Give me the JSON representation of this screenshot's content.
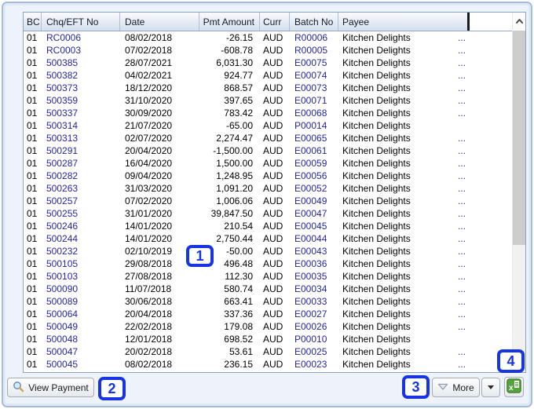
{
  "table": {
    "columns": [
      {
        "key": "bc",
        "label": "BC"
      },
      {
        "key": "chq",
        "label": "Chq/EFT No"
      },
      {
        "key": "date",
        "label": "Date"
      },
      {
        "key": "amount",
        "label": "Pmt Amount"
      },
      {
        "key": "curr",
        "label": "Curr"
      },
      {
        "key": "batch",
        "label": "Batch No"
      },
      {
        "key": "payee",
        "label": "Payee"
      }
    ],
    "rows": [
      {
        "bc": "01",
        "chq": "RC0006",
        "date": "08/02/2018",
        "amount": "-26.15",
        "curr": "AUD",
        "batch": "R00006",
        "payee": "Kitchen Delights",
        "more": "..."
      },
      {
        "bc": "01",
        "chq": "RC0003",
        "date": "07/02/2018",
        "amount": "-608.78",
        "curr": "AUD",
        "batch": "R00005",
        "payee": "Kitchen Delights",
        "more": "..."
      },
      {
        "bc": "01",
        "chq": "500385",
        "date": "28/07/2021",
        "amount": "6,031.30",
        "curr": "AUD",
        "batch": "E00075",
        "payee": "Kitchen Delights",
        "more": "..."
      },
      {
        "bc": "01",
        "chq": "500382",
        "date": "04/02/2021",
        "amount": "924.77",
        "curr": "AUD",
        "batch": "E00074",
        "payee": "Kitchen Delights",
        "more": "..."
      },
      {
        "bc": "01",
        "chq": "500373",
        "date": "18/12/2020",
        "amount": "868.57",
        "curr": "AUD",
        "batch": "E00073",
        "payee": "Kitchen Delights",
        "more": "..."
      },
      {
        "bc": "01",
        "chq": "500359",
        "date": "31/10/2020",
        "amount": "397.65",
        "curr": "AUD",
        "batch": "E00071",
        "payee": "Kitchen Delights",
        "more": "..."
      },
      {
        "bc": "01",
        "chq": "500337",
        "date": "30/09/2020",
        "amount": "783.42",
        "curr": "AUD",
        "batch": "E00068",
        "payee": "Kitchen Delights",
        "more": "..."
      },
      {
        "bc": "01",
        "chq": "500314",
        "date": "21/07/2020",
        "amount": "-65.00",
        "curr": "AUD",
        "batch": "P00014",
        "payee": "Kitchen Delights",
        "more": ""
      },
      {
        "bc": "01",
        "chq": "500313",
        "date": "02/07/2020",
        "amount": "2,274.47",
        "curr": "AUD",
        "batch": "E00065",
        "payee": "Kitchen Delights",
        "more": "..."
      },
      {
        "bc": "01",
        "chq": "500291",
        "date": "20/04/2020",
        "amount": "-1,500.00",
        "curr": "AUD",
        "batch": "E00061",
        "payee": "Kitchen Delights",
        "more": "..."
      },
      {
        "bc": "01",
        "chq": "500287",
        "date": "16/04/2020",
        "amount": "1,500.00",
        "curr": "AUD",
        "batch": "E00059",
        "payee": "Kitchen Delights",
        "more": "..."
      },
      {
        "bc": "01",
        "chq": "500282",
        "date": "09/04/2020",
        "amount": "1,248.95",
        "curr": "AUD",
        "batch": "E00056",
        "payee": "Kitchen Delights",
        "more": "..."
      },
      {
        "bc": "01",
        "chq": "500263",
        "date": "31/03/2020",
        "amount": "1,091.20",
        "curr": "AUD",
        "batch": "E00052",
        "payee": "Kitchen Delights",
        "more": "..."
      },
      {
        "bc": "01",
        "chq": "500257",
        "date": "07/02/2020",
        "amount": "1,006.06",
        "curr": "AUD",
        "batch": "E00049",
        "payee": "Kitchen Delights",
        "more": "..."
      },
      {
        "bc": "01",
        "chq": "500255",
        "date": "31/01/2020",
        "amount": "39,847.50",
        "curr": "AUD",
        "batch": "E00047",
        "payee": "Kitchen Delights",
        "more": "..."
      },
      {
        "bc": "01",
        "chq": "500246",
        "date": "14/01/2020",
        "amount": "210.54",
        "curr": "AUD",
        "batch": "E00045",
        "payee": "Kitchen Delights",
        "more": "..."
      },
      {
        "bc": "01",
        "chq": "500244",
        "date": "14/01/2020",
        "amount": "2,750.44",
        "curr": "AUD",
        "batch": "E00044",
        "payee": "Kitchen Delights",
        "more": "..."
      },
      {
        "bc": "01",
        "chq": "500232",
        "date": "02/10/2019",
        "amount": "-50.00",
        "curr": "AUD",
        "batch": "E00043",
        "payee": "Kitchen Delights",
        "more": "..."
      },
      {
        "bc": "01",
        "chq": "500105",
        "date": "29/08/2018",
        "amount": "496.48",
        "curr": "AUD",
        "batch": "E00036",
        "payee": "Kitchen Delights",
        "more": "..."
      },
      {
        "bc": "01",
        "chq": "500103",
        "date": "27/08/2018",
        "amount": "112.30",
        "curr": "AUD",
        "batch": "E00035",
        "payee": "Kitchen Delights",
        "more": "..."
      },
      {
        "bc": "01",
        "chq": "500090",
        "date": "11/07/2018",
        "amount": "580.74",
        "curr": "AUD",
        "batch": "E00034",
        "payee": "Kitchen Delights",
        "more": "..."
      },
      {
        "bc": "01",
        "chq": "500089",
        "date": "30/06/2018",
        "amount": "663.41",
        "curr": "AUD",
        "batch": "E00033",
        "payee": "Kitchen Delights",
        "more": "..."
      },
      {
        "bc": "01",
        "chq": "500064",
        "date": "20/04/2018",
        "amount": "337.36",
        "curr": "AUD",
        "batch": "E00027",
        "payee": "Kitchen Delights",
        "more": "..."
      },
      {
        "bc": "01",
        "chq": "500049",
        "date": "22/02/2018",
        "amount": "179.08",
        "curr": "AUD",
        "batch": "E00026",
        "payee": "Kitchen Delights",
        "more": "..."
      },
      {
        "bc": "01",
        "chq": "500048",
        "date": "12/01/2018",
        "amount": "698.52",
        "curr": "AUD",
        "batch": "P00010",
        "payee": "Kitchen Delights",
        "more": ""
      },
      {
        "bc": "01",
        "chq": "500047",
        "date": "20/02/2018",
        "amount": "53.61",
        "curr": "AUD",
        "batch": "E00025",
        "payee": "Kitchen Delights",
        "more": "..."
      },
      {
        "bc": "01",
        "chq": "500045",
        "date": "08/02/2018",
        "amount": "236.15",
        "curr": "AUD",
        "batch": "E00023",
        "payee": "Kitchen Delights",
        "more": "..."
      }
    ]
  },
  "toolbar": {
    "view_payment_label": "View Payment",
    "more_label": "More",
    "icons": {
      "view_payment": "magnifier-icon",
      "more": "filter-icon",
      "dropdown": "chevron-down-icon",
      "export": "excel-export-icon"
    }
  },
  "scrollbar": {
    "up_icon": "chevron-up-icon"
  },
  "callouts": [
    {
      "n": "1"
    },
    {
      "n": "2"
    },
    {
      "n": "3"
    },
    {
      "n": "4"
    }
  ],
  "colors": {
    "callout_blue": "#1634e3",
    "link_navy": "#26269e",
    "header_gradient_bottom": "#d4dfee",
    "excel_green": "#55a23e"
  }
}
